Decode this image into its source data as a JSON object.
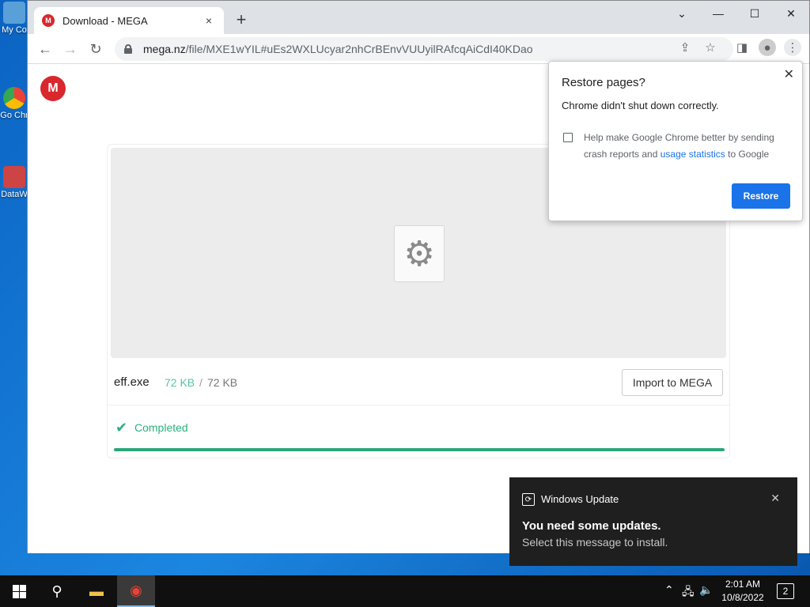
{
  "desktop": {
    "icons": [
      {
        "label": "My Co"
      },
      {
        "label": "Go Chr"
      },
      {
        "label": "DataW"
      }
    ]
  },
  "browser": {
    "tab": {
      "title": "Download - MEGA",
      "favicon": "M",
      "close": "×"
    },
    "new_tab": "+",
    "window": {
      "minimize": "—",
      "maximize": "☐",
      "close": "✕",
      "tabsearch": "⌄"
    },
    "nav": {
      "back": "←",
      "forward": "→",
      "reload": "↻"
    },
    "omnibox": {
      "host": "mega.nz",
      "path": "/file/MXE1wYIL#uEs2WXLUcyar2nhCrBEnvVUUyilRAfcqAiCdI40KDao"
    },
    "icons": {
      "share": "⇪",
      "star": "☆",
      "sidepanel": "◨",
      "profile": "●",
      "menu": "⋮"
    }
  },
  "mega": {
    "logo": "M",
    "file_icon": "⚙",
    "file_name": "eff.exe",
    "size_done": "72 KB",
    "size_sep": "/",
    "size_total": "72 KB",
    "import_label": "Import to MEGA",
    "status_check": "✔",
    "status": "Completed",
    "progress": 1.0
  },
  "restore_popup": {
    "close": "✕",
    "title": "Restore pages?",
    "message": "Chrome didn't shut down correctly.",
    "help_prefix": "Help make Google Chrome better by sending crash reports and",
    "help_link": "usage statistics",
    "help_suffix": "to Google",
    "button": "Restore"
  },
  "toast": {
    "icon": "⟳",
    "app": "Windows Update",
    "close": "✕",
    "title": "You need some updates.",
    "body": "Select this message to install."
  },
  "taskbar": {
    "search_glyph": "⚲",
    "folder_glyph": "▬",
    "chrome_glyph": "◉",
    "tray": {
      "up": "⌃",
      "network": "🖧",
      "volume": "🔈"
    },
    "time": "2:01 AM",
    "date": "10/8/2022",
    "notifications": "2"
  },
  "colors": {
    "accent": "#1a73e8",
    "mega_red": "#d9272e",
    "success": "#2ba67a"
  }
}
